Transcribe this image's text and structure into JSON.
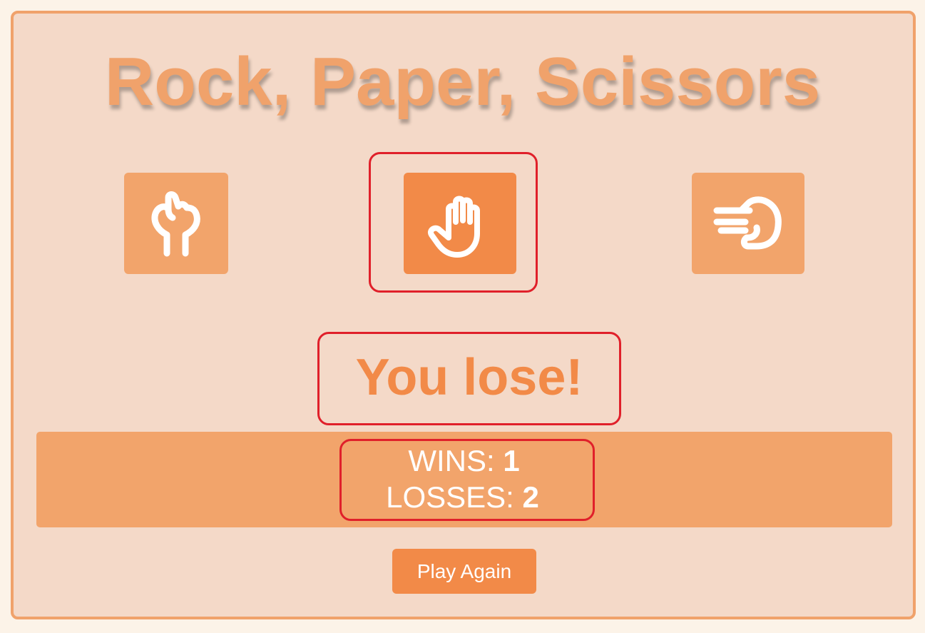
{
  "title": "Rock, Paper, Scissors",
  "choices": [
    {
      "label": "rock",
      "icon": "fist-icon",
      "selected": false
    },
    {
      "label": "paper",
      "icon": "open-hand-icon",
      "selected": true
    },
    {
      "label": "scissors",
      "icon": "scissors-hand-icon",
      "selected": false
    }
  ],
  "result": "You lose!",
  "score": {
    "wins_label": "WINS:",
    "wins": "1",
    "losses_label": "LOSSES:",
    "losses": "2"
  },
  "play_again_label": "Play Again",
  "colors": {
    "page_bg": "#fcf3e8",
    "panel_bg": "#f4d9c8",
    "accent": "#f0a26b",
    "accent_dark": "#f28a48",
    "highlight": "#e0202a",
    "text_light": "#ffffff"
  }
}
